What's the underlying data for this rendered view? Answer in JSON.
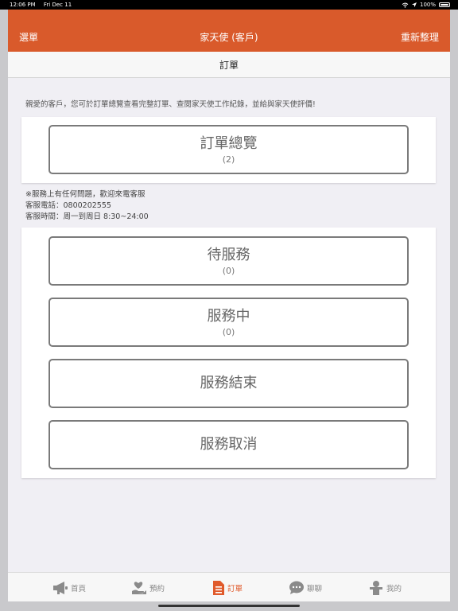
{
  "status_bar": {
    "time": "12:06 PM",
    "date": "Fri Dec 11",
    "battery": "100%"
  },
  "nav": {
    "left": "選單",
    "title": "家天使 (客戶)",
    "right": "重新整理"
  },
  "sub_header": {
    "title": "訂單"
  },
  "intro": "親愛的客戶，您可於訂單總覽查看完整訂單、查閱家天使工作紀錄，並給與家天使評價!",
  "overview": {
    "label": "訂單總覽",
    "count": "(2)"
  },
  "contact": {
    "line1": "※服務上有任何問題，歡迎來電客服",
    "line2": "客服電話：0800202555",
    "line3": "客服時間：周一到周日 8:30~24:00"
  },
  "status_buttons": [
    {
      "label": "待服務",
      "count": "(0)"
    },
    {
      "label": "服務中",
      "count": "(0)"
    },
    {
      "label": "服務結束"
    },
    {
      "label": "服務取消"
    }
  ],
  "tabs": [
    {
      "label": "首頁",
      "icon": "megaphone-icon"
    },
    {
      "label": "預約",
      "icon": "heart-hand-icon"
    },
    {
      "label": "訂單",
      "icon": "document-icon",
      "active": true
    },
    {
      "label": "聊聊",
      "icon": "chat-bubble-icon"
    },
    {
      "label": "我的",
      "icon": "person-icon"
    }
  ],
  "colors": {
    "accent": "#d95a2b",
    "tab_active": "#e05a2b",
    "tab_inactive": "#8a8a8a",
    "background": "#f0eff4"
  }
}
